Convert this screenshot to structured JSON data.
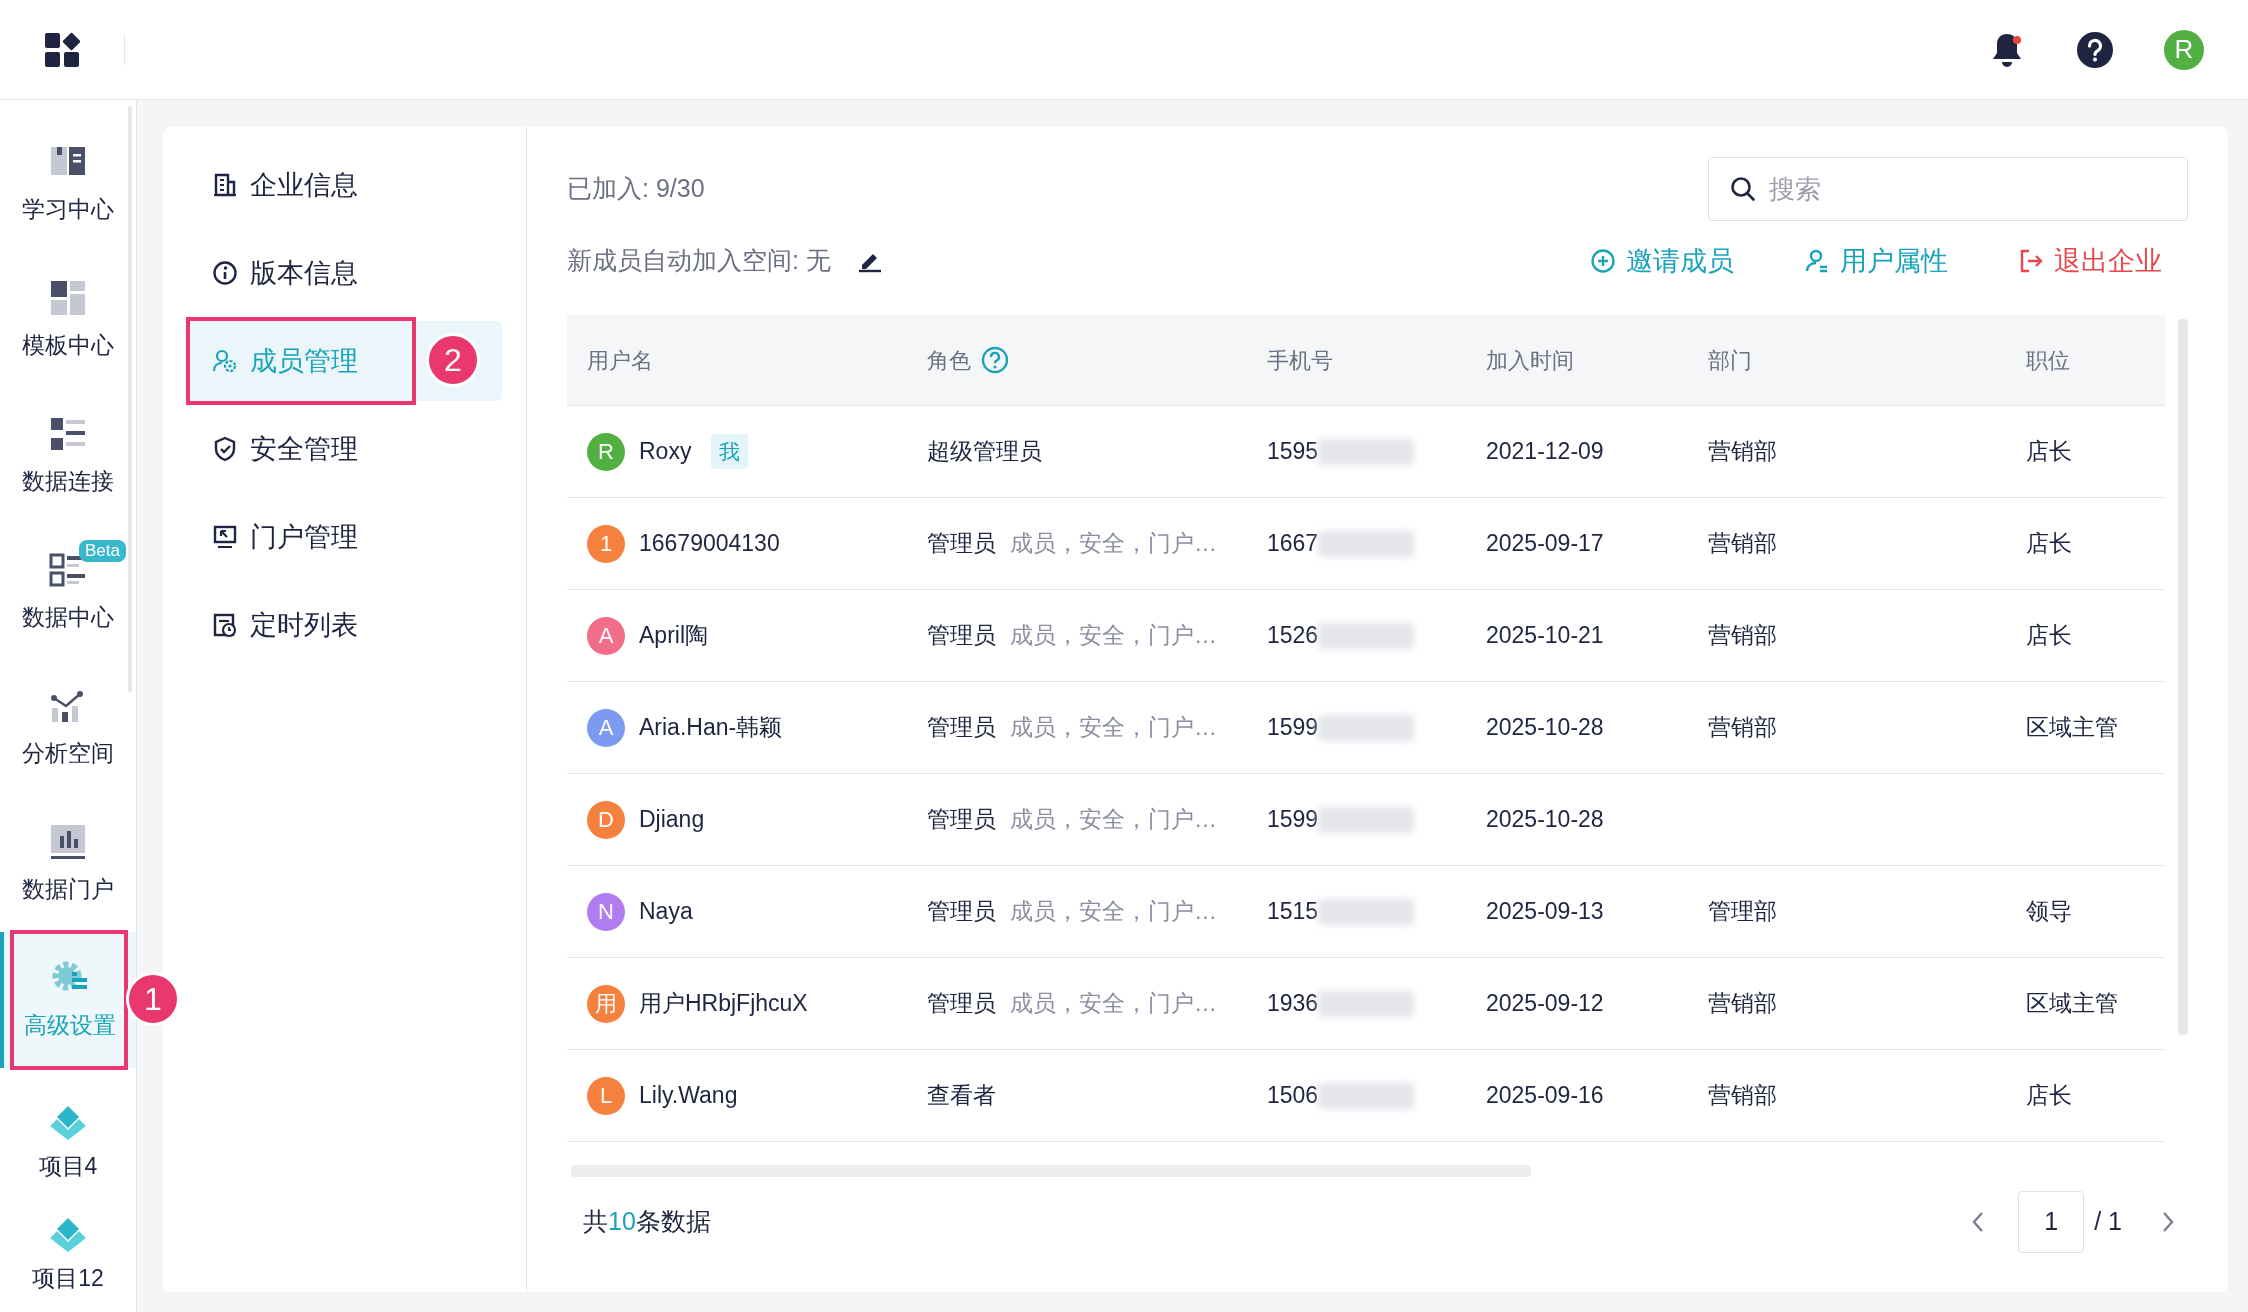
{
  "top_bar": {
    "avatar": "R"
  },
  "sidebar": {
    "items": [
      {
        "kind": "book",
        "label": "学习中心",
        "selected": false
      },
      {
        "kind": "template",
        "label": "模板中心",
        "selected": false
      },
      {
        "kind": "connect",
        "label": "数据连接",
        "selected": false
      },
      {
        "kind": "datacenter",
        "label": "数据中心",
        "selected": false,
        "badge": "Beta"
      },
      {
        "kind": "analysis",
        "label": "分析空间",
        "selected": false
      },
      {
        "kind": "portal",
        "label": "数据门户",
        "selected": false
      },
      {
        "kind": "settings",
        "label": "高级设置",
        "selected": true,
        "annotation": "1"
      }
    ],
    "projects": [
      {
        "label": "项目4"
      },
      {
        "label": "项目12"
      }
    ]
  },
  "settings_menu": [
    {
      "kind": "building",
      "label": "企业信息",
      "selected": false
    },
    {
      "kind": "info",
      "label": "版本信息",
      "selected": false
    },
    {
      "kind": "members",
      "label": "成员管理",
      "selected": true,
      "annotation": "2"
    },
    {
      "kind": "shield",
      "label": "安全管理",
      "selected": false
    },
    {
      "kind": "screen",
      "label": "门户管理",
      "selected": false
    },
    {
      "kind": "schedule",
      "label": "定时列表",
      "selected": false
    }
  ],
  "members": {
    "joined": "已加入: 9/30",
    "auto_join": "新成员自动加入空间: 无",
    "search": {
      "placeholder": "搜索"
    },
    "actions": [
      {
        "kind": "invite",
        "label": "邀请成员"
      },
      {
        "kind": "attributes",
        "label": "用户属性"
      },
      {
        "kind": "leave",
        "label": "退出企业"
      }
    ],
    "table": {
      "columns": [
        "用户名",
        "角色",
        "手机号",
        "加入时间",
        "部门",
        "职位"
      ],
      "rows": [
        {
          "avatar": "R",
          "color": "#52b043",
          "name": "Roxy",
          "tag": "我",
          "role": "超级管理员",
          "phone": "1595",
          "joined": "2021-12-09",
          "department": "营销部",
          "position": "店长"
        },
        {
          "avatar": "1",
          "color": "#f5813f",
          "name": "16679004130",
          "role": "管理员",
          "permissions": "成员，安全，门户…",
          "phone": "1667",
          "joined": "2025-09-17",
          "department": "营销部",
          "position": "店长"
        },
        {
          "avatar": "A",
          "color": "#f06e8a",
          "name": "April陶",
          "role": "管理员",
          "permissions": "成员，安全，门户…",
          "phone": "1526",
          "joined": "2025-10-21",
          "department": "营销部",
          "position": "店长"
        },
        {
          "avatar": "A",
          "color": "#7b9af0",
          "name": "Aria.Han-韩颖",
          "role": "管理员",
          "permissions": "成员，安全，门户…",
          "phone": "1599",
          "joined": "2025-10-28",
          "department": "营销部",
          "position": "区域主管"
        },
        {
          "avatar": "D",
          "color": "#f5813f",
          "name": "Djiang",
          "role": "管理员",
          "permissions": "成员，安全，门户…",
          "phone": "1599",
          "joined": "2025-10-28"
        },
        {
          "avatar": "N",
          "color": "#b07cf0",
          "name": "Naya",
          "role": "管理员",
          "permissions": "成员，安全，门户…",
          "phone": "1515",
          "joined": "2025-09-13",
          "department": "管理部",
          "position": "领导"
        },
        {
          "avatar": "用",
          "color": "#f5813f",
          "name": "用户HRbjFjhcuX",
          "role": "管理员",
          "permissions": "成员，安全，门户…",
          "phone": "1936",
          "joined": "2025-09-12",
          "department": "营销部",
          "position": "区域主管"
        },
        {
          "avatar": "L",
          "color": "#f5813f",
          "name": "Lily.Wang",
          "role": "查看者",
          "phone": "1506",
          "joined": "2025-09-16",
          "department": "营销部",
          "position": "店长"
        }
      ]
    },
    "footer": {
      "total_prefix": "共",
      "total": "10",
      "total_suffix": "条数据",
      "page": "1",
      "pages": "/ 1"
    }
  }
}
